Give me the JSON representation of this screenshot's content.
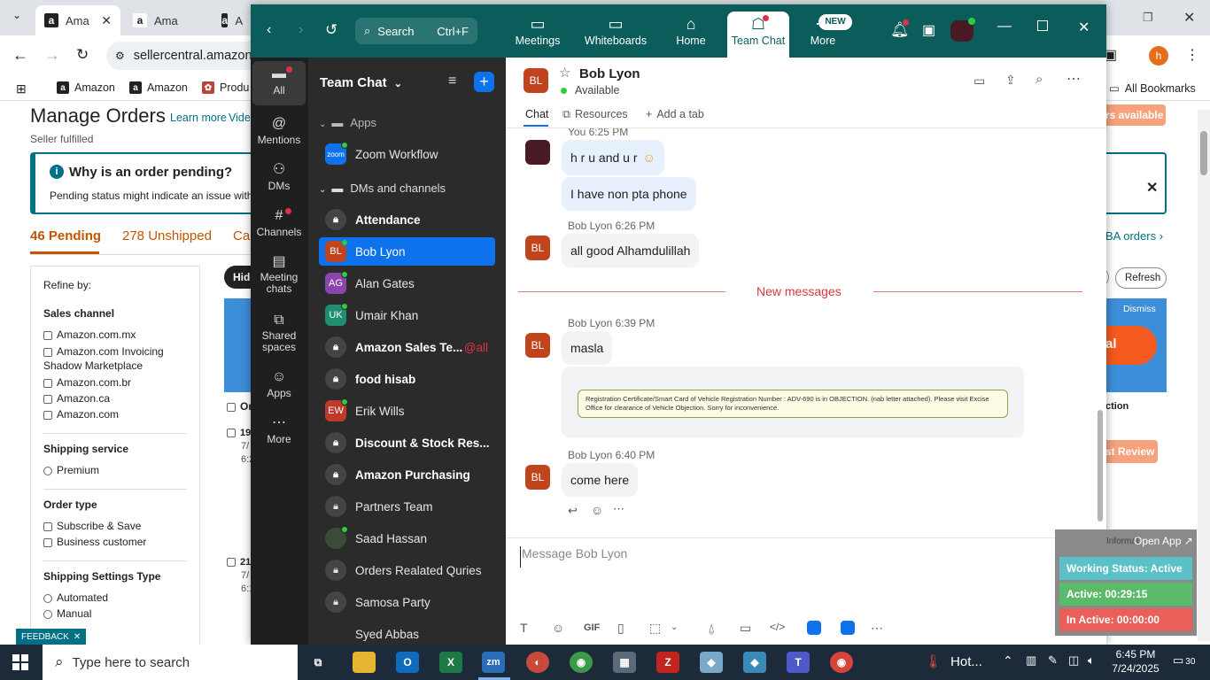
{
  "browser": {
    "tabs": [
      "Ama",
      "Ama",
      "A"
    ],
    "url": "sellercentral.amazon",
    "bookmarks": [
      "Amazon",
      "Amazon",
      "Produ"
    ],
    "all_bookmarks": "All Bookmarks",
    "profile_initial": "h"
  },
  "amazon": {
    "title": "Manage Orders",
    "learn_more": "Learn more",
    "video": "Vide",
    "subtitle": "Seller fulfilled",
    "banner_title": "Why is an order pending?",
    "banner_text": "Pending status might indicate an issue with t",
    "tab_pending": "46 Pending",
    "tab_unshipped": "278 Unshipped",
    "tab_cancel": "Ca",
    "refine_by": "Refine by:",
    "sales_channel_heading": "Sales channel",
    "sales_channels": [
      "Amazon.com.mx",
      "Amazon.com Invoicing Shadow Marketplace",
      "Amazon.com.br",
      "Amazon.ca",
      "Amazon.com"
    ],
    "shipping_service_heading": "Shipping service",
    "shipping_services": [
      "Premium"
    ],
    "order_type_heading": "Order type",
    "order_types": [
      "Subscribe & Save",
      "Business customer"
    ],
    "shipping_settings_heading": "Shipping Settings Type",
    "shipping_settings": [
      "Automated",
      "Manual"
    ],
    "feedback": "FEEDBACK",
    "hide": "Hide",
    "or": "Or",
    "row1_a": "19",
    "row1_b": "7/",
    "row1_c": "6:2",
    "row2_a": "21",
    "row2_b": "7/",
    "row2_c": "6:1",
    "rs_available": "rs available",
    "fba_orders": "BA orders",
    "refresh": "Refresh",
    "dismiss": "Dismiss",
    "al": "al",
    "ction": "ction",
    "review": "st Review"
  },
  "zoom": {
    "search_label": "Search",
    "search_shortcut": "Ctrl+F",
    "nav_tabs": [
      {
        "label": "Meetings",
        "icon": "video-icon"
      },
      {
        "label": "Whiteboards",
        "icon": "whiteboard-icon"
      },
      {
        "label": "Home",
        "icon": "home-icon"
      },
      {
        "label": "Team Chat",
        "icon": "chat-icon"
      },
      {
        "label": "More",
        "icon": "more-icon"
      }
    ],
    "new_badge": "NEW",
    "rail": [
      "All",
      "Mentions",
      "DMs",
      "Channels",
      "Meeting chats",
      "Shared spaces",
      "Apps",
      "More"
    ],
    "list_title": "Team Chat",
    "section_apps": "Apps",
    "section_dms": "DMs and channels",
    "app_item": "Zoom Workflow",
    "app_logo": "zoom",
    "items": [
      {
        "name": "Attendance",
        "initials": "",
        "bold": true
      },
      {
        "name": "Bob Lyon",
        "initials": "BL",
        "bold": false
      },
      {
        "name": "Alan Gates",
        "initials": "AG",
        "bold": false
      },
      {
        "name": "Umair Khan",
        "initials": "UK",
        "bold": false
      },
      {
        "name": "Amazon Sales Te...",
        "initials": "",
        "bold": true,
        "mention": "@all"
      },
      {
        "name": "food hisab",
        "initials": "",
        "bold": true
      },
      {
        "name": "Erik Wills",
        "initials": "EW",
        "bold": false
      },
      {
        "name": "Discount & Stock Res...",
        "initials": "",
        "bold": true
      },
      {
        "name": "Amazon Purchasing",
        "initials": "",
        "bold": true
      },
      {
        "name": "Partners Team",
        "initials": "",
        "bold": false
      },
      {
        "name": "Saad Hassan",
        "initials": "",
        "bold": false
      },
      {
        "name": "Orders Realated Quries",
        "initials": "",
        "bold": false
      },
      {
        "name": "Samosa Party",
        "initials": "",
        "bold": false
      },
      {
        "name": "Syed Abbas",
        "initials": "",
        "bold": false
      }
    ],
    "contact_initials": "BL",
    "contact_name": "Bob Lyon",
    "contact_status": "Available",
    "chat_tabs": [
      "Chat",
      "Resources",
      "Add a tab"
    ],
    "messages": {
      "you_meta": "You 6:25 PM",
      "you_msg1": "h r u and  u r",
      "you_msg2": "I have non pta phone",
      "bob_meta1": "Bob Lyon 6:26 PM",
      "bob_msg1": "all good Alhamdulillah",
      "new_messages": "New messages",
      "bob_meta2": "Bob Lyon 6:39 PM",
      "bob_msg2": "masla",
      "attachment_text": "Registration Certificate/Smart Card of Vehicle Registration Number : ADV-690 is in OBJECTION. (nab letter attached). Please visit Excise Office for clearance of Vehicle Objection. Sorry for inconvenience.",
      "bob_meta3": "Bob Lyon 6:40 PM",
      "bob_msg3": "come here"
    },
    "composer_placeholder": "Message Bob Lyon",
    "gif": "GIF"
  },
  "widget": {
    "open_app": "Open App",
    "informa": "Informat",
    "working_status": "Working Status: Active",
    "active": "Active: 00:29:15",
    "inactive": "In Active: 00:00:00"
  },
  "taskbar": {
    "search_placeholder": "Type here to search",
    "weather": "Hot...",
    "time": "6:45 PM",
    "date": "7/24/2025",
    "notifications": "30"
  },
  "colors": {
    "zoom_header": "#0b5d5c",
    "zoom_blue": "#0e72ed",
    "amazon_link": "#007185",
    "widget_teal": "#5bc0c8",
    "widget_green": "#5cbb6b",
    "widget_red": "#e9605a"
  }
}
